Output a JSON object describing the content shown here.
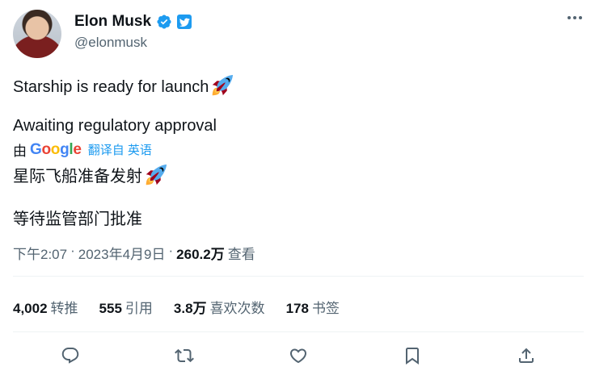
{
  "author": {
    "name": "Elon Musk",
    "handle": "@elonmusk"
  },
  "tweet": {
    "line1": "Starship is ready for launch",
    "line2": "Awaiting regulatory approval"
  },
  "translation": {
    "by": "由",
    "provider": "Google",
    "link": "翻译自 英语",
    "line1": "星际飞船准备发射",
    "line2": "等待监管部门批准"
  },
  "meta": {
    "time": "下午2:07",
    "sep1": "·",
    "date": "2023年4月9日",
    "sep2": "·",
    "views_count": "260.2万",
    "views_label": "查看"
  },
  "stats": [
    {
      "num": "4,002",
      "label": "转推"
    },
    {
      "num": "555",
      "label": "引用"
    },
    {
      "num": "3.8万",
      "label": "喜欢次数"
    },
    {
      "num": "178",
      "label": "书签"
    }
  ],
  "colors": {
    "accent": "#1d9bf0",
    "muted": "#536471",
    "text": "#0f1419",
    "divider": "#eff3f4"
  },
  "icons": [
    "verified-badge-icon",
    "twitter-logo-icon",
    "more-icon",
    "rocket-emoji-icon",
    "reply-icon",
    "retweet-icon",
    "like-icon",
    "bookmark-icon",
    "share-icon"
  ]
}
